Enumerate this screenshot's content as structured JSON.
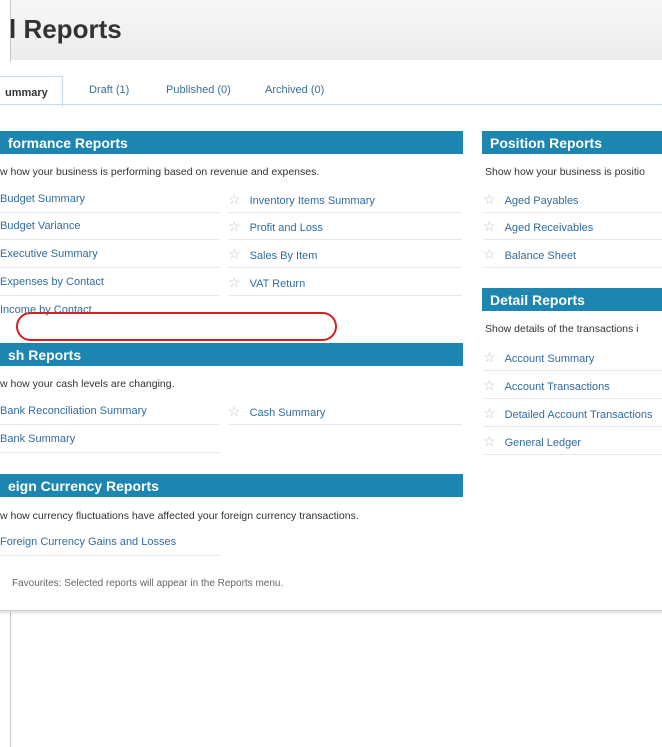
{
  "page": {
    "title": "l Reports"
  },
  "tabs": [
    {
      "label": "ummary",
      "active": true
    },
    {
      "label": "Draft (1)",
      "active": false
    },
    {
      "label": "Published (0)",
      "active": false
    },
    {
      "label": "Archived (0)",
      "active": false
    }
  ],
  "performance": {
    "title": "formance Reports",
    "description": "w how your business is performing based on revenue and expenses.",
    "left_items": [
      "Budget Summary",
      "Budget Variance",
      "Executive Summary",
      "Expenses by Contact",
      "Income by Contact"
    ],
    "right_items": [
      "Inventory Items Summary",
      "Profit and Loss",
      "Sales By Item",
      "VAT Return"
    ]
  },
  "cash": {
    "title": "sh Reports",
    "description": "w how your cash levels are changing.",
    "left_items": [
      "Bank Reconciliation Summary",
      "Bank Summary"
    ],
    "right_items": [
      "Cash Summary"
    ]
  },
  "foreign": {
    "title": "eign Currency Reports",
    "description": "w how currency fluctuations have affected your foreign currency transactions.",
    "left_items": [
      "Foreign Currency Gains and Losses"
    ]
  },
  "position": {
    "title": "Position Reports",
    "description": "Show how your business is positio",
    "items": [
      "Aged Payables",
      "Aged Receivables",
      "Balance Sheet"
    ]
  },
  "detail": {
    "title": "Detail Reports",
    "description": "Show details of the transactions i",
    "items": [
      "Account Summary",
      "Account Transactions",
      "Detailed Account Transactions",
      "General Ledger"
    ]
  },
  "footer": {
    "text": "Favourites: Selected reports will appear in the Reports menu."
  },
  "colors": {
    "header_blue": "#1d86b0",
    "link_blue": "#326ca0",
    "highlight_red": "#d81f1f"
  }
}
